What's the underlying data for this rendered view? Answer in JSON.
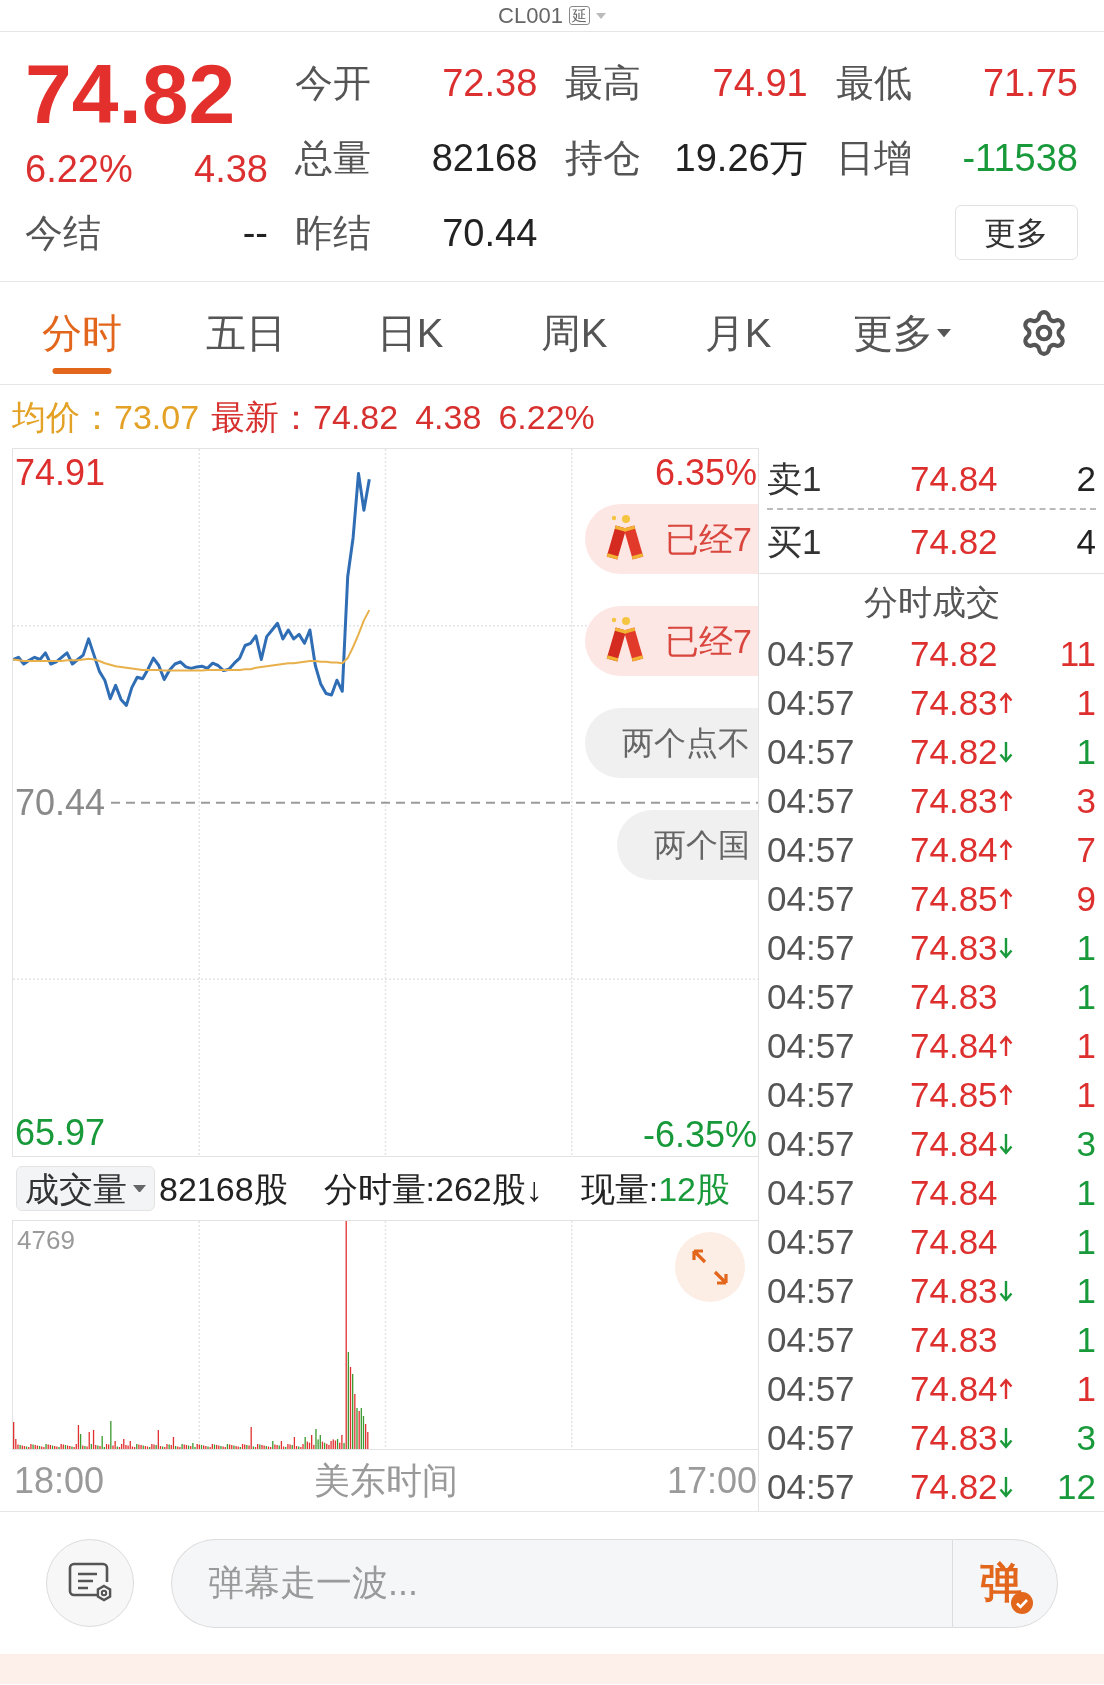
{
  "title": {
    "symbol": "CL001",
    "badge": "延"
  },
  "quote": {
    "price": "74.82",
    "change_pct": "6.22%",
    "change": "4.38",
    "settle_label": "今结",
    "settle_value": "--"
  },
  "stats": [
    {
      "label": "今开",
      "value": "72.38",
      "color": "#dc3030"
    },
    {
      "label": "最高",
      "value": "74.91",
      "color": "#dc3030"
    },
    {
      "label": "最低",
      "value": "71.75",
      "color": "#dc3030"
    },
    {
      "label": "总量",
      "value": "82168",
      "color": "#222222"
    },
    {
      "label": "持仓",
      "value": "19.26万",
      "color": "#222222"
    },
    {
      "label": "日增",
      "value": "-11538",
      "color": "#18993a"
    },
    {
      "label": "昨结",
      "value": "70.44",
      "color": "#222222"
    }
  ],
  "more_button": "更多",
  "tabs": [
    {
      "label": "分时",
      "kind": "view",
      "selected": true
    },
    {
      "label": "五日",
      "kind": "view",
      "selected": false
    },
    {
      "label": "日K",
      "kind": "view",
      "selected": false
    },
    {
      "label": "周K",
      "kind": "view",
      "selected": false
    },
    {
      "label": "月K",
      "kind": "view",
      "selected": false
    },
    {
      "label": "更多",
      "kind": "menu",
      "selected": false
    }
  ],
  "info_line": {
    "avg_label": "均价：",
    "avg": "73.07",
    "last_label": "最新：",
    "last": "74.82",
    "change": "4.38",
    "change_pct": "6.22%"
  },
  "price_chart": {
    "chart_data": {
      "type": "line",
      "categories": [
        null,
        null,
        null,
        null,
        null,
        null,
        null,
        null,
        null,
        null,
        null,
        null,
        null,
        null,
        null,
        null,
        null,
        null,
        null,
        null,
        null,
        null,
        null,
        null,
        null,
        null,
        null,
        null,
        null,
        null,
        null,
        null,
        null,
        null,
        null,
        null,
        null,
        null,
        null,
        null,
        null,
        null,
        null,
        null,
        null,
        null,
        null,
        null,
        null,
        null,
        null,
        null,
        null,
        null,
        null,
        null,
        null,
        null,
        null,
        null,
        null,
        null,
        null,
        null,
        null,
        null,
        null,
        null,
        null,
        null,
        null,
        null,
        null,
        null,
        null,
        null,
        null,
        null,
        null,
        null,
        null,
        null,
        null,
        null,
        null,
        null,
        null,
        null,
        null,
        null,
        null,
        null,
        null,
        null,
        null,
        null,
        null,
        null,
        null,
        null,
        null,
        null,
        null,
        null,
        null,
        null,
        null,
        null,
        null,
        null,
        null,
        null,
        null,
        null,
        null,
        null,
        null,
        null,
        null,
        null,
        null,
        null,
        null,
        null,
        null,
        null,
        null,
        null,
        null,
        null,
        null,
        null,
        null,
        null,
        null,
        null,
        null,
        null,
        null
      ],
      "ylim": [
        65.66,
        75.23
      ],
      "yticks": [
        {
          "value": 74.91,
          "label": "74.91"
        },
        {
          "value": 70.44,
          "label": "70.44"
        },
        {
          "value": 65.97,
          "label": "65.97"
        }
      ],
      "ref_lines": [
        {
          "axis": "y",
          "value": 70.44
        }
      ],
      "series": [
        {
          "color": "#2f6db5",
          "values": [
            72.38,
            72.41,
            72.32,
            72.37,
            72.41,
            72.38,
            72.47,
            72.32,
            72.35,
            72.41,
            72.47,
            72.32,
            72.38,
            72.44,
            72.66,
            72.44,
            72.22,
            72.1,
            71.85,
            72.03,
            71.84,
            71.76,
            72,
            72.14,
            72.12,
            72.25,
            72.4,
            72.3,
            72.11,
            72.24,
            72.32,
            72.35,
            72.28,
            72.26,
            72.28,
            72.29,
            72.26,
            72.33,
            72.3,
            72.23,
            72.25,
            72.33,
            72.4,
            72.57,
            72.6,
            72.7,
            72.38,
            72.69,
            72.78,
            72.87,
            72.66,
            72.78,
            72.66,
            72.72,
            72.6,
            72.78,
            72.3,
            72.05,
            71.92,
            71.9,
            72.1,
            71.95,
            73.5,
            74.03,
            74.9,
            74.4,
            74.82,
            null,
            null,
            null,
            null,
            null,
            null,
            null,
            null,
            null,
            null,
            null,
            null,
            null,
            null,
            null,
            null,
            null,
            null,
            null,
            null,
            null,
            null,
            null,
            null,
            null,
            null,
            null,
            null,
            null,
            null,
            null,
            null,
            null,
            null,
            null,
            null,
            null,
            null,
            null,
            null,
            null,
            null,
            null,
            null,
            null,
            null,
            null,
            null,
            null,
            null,
            null,
            null,
            null,
            null,
            null,
            null,
            null,
            null,
            null,
            null,
            null,
            null,
            null,
            null,
            null,
            null,
            null,
            null,
            null,
            null,
            null,
            null
          ]
        },
        {
          "color": "#e8b04a",
          "values": [
            72.38,
            72.37,
            72.36,
            72.36,
            72.36,
            72.36,
            72.36,
            72.36,
            72.36,
            72.36,
            72.37,
            72.37,
            72.37,
            72.38,
            72.39,
            72.38,
            72.36,
            72.33,
            72.31,
            72.29,
            72.28,
            72.27,
            72.26,
            72.25,
            72.24,
            72.24,
            72.24,
            72.24,
            72.23,
            72.23,
            72.23,
            72.23,
            72.23,
            72.23,
            72.23,
            72.23,
            72.24,
            72.24,
            72.24,
            72.24,
            72.24,
            72.24,
            72.24,
            72.25,
            72.25,
            72.27,
            72.28,
            72.29,
            72.3,
            72.31,
            72.32,
            72.33,
            72.33,
            72.34,
            72.35,
            72.36,
            72.36,
            72.35,
            72.35,
            72.34,
            72.34,
            72.33,
            72.4,
            72.55,
            72.72,
            72.91,
            73.05,
            null,
            null,
            null,
            null,
            null,
            null,
            null,
            null,
            null,
            null,
            null,
            null,
            null,
            null,
            null,
            null,
            null,
            null,
            null,
            null,
            null,
            null,
            null,
            null,
            null,
            null,
            null,
            null,
            null,
            null,
            null,
            null,
            null,
            null,
            null,
            null,
            null,
            null,
            null,
            null,
            null,
            null,
            null,
            null,
            null,
            null,
            null,
            null,
            null,
            null,
            null,
            null,
            null,
            null,
            null,
            null,
            null,
            null,
            null,
            null,
            null,
            null,
            null,
            null,
            null,
            null,
            null,
            null,
            null,
            null,
            null,
            null
          ]
        }
      ]
    },
    "right_ticks": [
      "6.35%",
      "-6.35%"
    ],
    "danmaku": [
      {
        "kind": "gift",
        "text": "已经7"
      },
      {
        "kind": "gift",
        "text": "已经7"
      },
      {
        "kind": "plain",
        "text": "两个点不"
      },
      {
        "kind": "plain",
        "text": "两个国"
      }
    ]
  },
  "volume": {
    "selector": "成交量",
    "total": "82168股",
    "minute_volume": "分时量:262股↓",
    "current_label": "现量:",
    "current": "12股",
    "max_label": "4769"
  },
  "time_axis": {
    "start": "18:00",
    "zone": "美东时间",
    "end": "17:00"
  },
  "order_book": [
    {
      "label": "卖1",
      "price": "74.84",
      "volume": "2"
    },
    {
      "label": "买1",
      "price": "74.82",
      "volume": "4"
    }
  ],
  "trades_title": "分时成交",
  "trades": [
    {
      "time": "04:57",
      "price": "74.82",
      "kind": "plain",
      "volume": "11",
      "color": "#dd2f2d"
    },
    {
      "time": "04:57",
      "price": "74.83",
      "kind": "up",
      "volume": "1",
      "color": "#dd2f2d"
    },
    {
      "time": "04:57",
      "price": "74.82",
      "kind": "down",
      "volume": "1",
      "color": "#18993a"
    },
    {
      "time": "04:57",
      "price": "74.83",
      "kind": "up",
      "volume": "3",
      "color": "#dd2f2d"
    },
    {
      "time": "04:57",
      "price": "74.84",
      "kind": "up",
      "volume": "7",
      "color": "#dd2f2d"
    },
    {
      "time": "04:57",
      "price": "74.85",
      "kind": "up",
      "volume": "9",
      "color": "#dd2f2d"
    },
    {
      "time": "04:57",
      "price": "74.83",
      "kind": "down",
      "volume": "1",
      "color": "#18993a"
    },
    {
      "time": "04:57",
      "price": "74.83",
      "kind": "plain",
      "volume": "1",
      "color": "#18993a"
    },
    {
      "time": "04:57",
      "price": "74.84",
      "kind": "up",
      "volume": "1",
      "color": "#dd2f2d"
    },
    {
      "time": "04:57",
      "price": "74.85",
      "kind": "up",
      "volume": "1",
      "color": "#dd2f2d"
    },
    {
      "time": "04:57",
      "price": "74.84",
      "kind": "down",
      "volume": "3",
      "color": "#18993a"
    },
    {
      "time": "04:57",
      "price": "74.84",
      "kind": "plain",
      "volume": "1",
      "color": "#18993a"
    },
    {
      "time": "04:57",
      "price": "74.84",
      "kind": "plain",
      "volume": "1",
      "color": "#18993a"
    },
    {
      "time": "04:57",
      "price": "74.83",
      "kind": "down",
      "volume": "1",
      "color": "#18993a"
    },
    {
      "time": "04:57",
      "price": "74.83",
      "kind": "plain",
      "volume": "1",
      "color": "#18993a"
    },
    {
      "time": "04:57",
      "price": "74.84",
      "kind": "up",
      "volume": "1",
      "color": "#dd2f2d"
    },
    {
      "time": "04:57",
      "price": "74.83",
      "kind": "down",
      "volume": "3",
      "color": "#18993a"
    },
    {
      "time": "04:57",
      "price": "74.82",
      "kind": "down",
      "volume": "12",
      "color": "#18993a"
    }
  ],
  "comment_bar": {
    "placeholder": "弹幕走一波...",
    "send": "弹"
  }
}
